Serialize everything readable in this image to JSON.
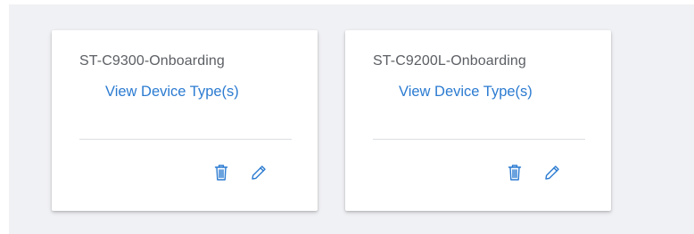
{
  "colors": {
    "background": "#f0f1f4",
    "card": "#ffffff",
    "title_text": "#5b5e63",
    "link": "#2b7bd1",
    "divider": "#dcdfe3"
  },
  "cards": [
    {
      "title": "ST-C9300-Onboarding",
      "link_label": "View Device Type(s)",
      "actions": [
        {
          "icon": "trash-icon"
        },
        {
          "icon": "pencil-icon"
        }
      ]
    },
    {
      "title": "ST-C9200L-Onboarding",
      "link_label": "View Device Type(s)",
      "actions": [
        {
          "icon": "trash-icon"
        },
        {
          "icon": "pencil-icon"
        }
      ]
    }
  ]
}
